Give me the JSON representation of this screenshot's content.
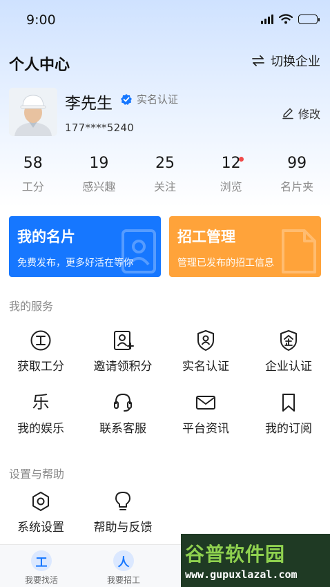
{
  "status_bar": {
    "time": "9:00"
  },
  "header": {
    "title": "个人中心",
    "switch_label": "切换企业"
  },
  "profile": {
    "name": "李先生",
    "verified_label": "实名认证",
    "phone": "177****5240",
    "edit_label": "修改"
  },
  "stats": [
    {
      "value": "58",
      "label": "工分"
    },
    {
      "value": "19",
      "label": "感兴趣"
    },
    {
      "value": "25",
      "label": "关注"
    },
    {
      "value": "12",
      "label": "浏览",
      "has_dot": true
    },
    {
      "value": "99",
      "label": "名片夹"
    }
  ],
  "cards": {
    "business_card": {
      "title": "我的名片",
      "subtitle": "免费发布，更多好活在等你",
      "color": "#1677ff"
    },
    "recruit_manage": {
      "title": "招工管理",
      "subtitle": "管理已发布的招工信息",
      "color": "#ffa33a"
    }
  },
  "services": {
    "title": "我的服务",
    "items": [
      {
        "label": "获取工分",
        "icon": "work-points-icon"
      },
      {
        "label": "邀请领积分",
        "icon": "invite-user-icon"
      },
      {
        "label": "实名认证",
        "icon": "id-shield-icon"
      },
      {
        "label": "企业认证",
        "icon": "enterprise-shield-icon"
      },
      {
        "label": "我的娱乐",
        "icon": "music-icon",
        "glyph": "乐"
      },
      {
        "label": "联系客服",
        "icon": "headset-icon"
      },
      {
        "label": "平台资讯",
        "icon": "mail-icon"
      },
      {
        "label": "我的订阅",
        "icon": "bookmark-icon"
      }
    ]
  },
  "settings": {
    "title": "设置与帮助",
    "items": [
      {
        "label": "系统设置",
        "icon": "settings-hex-icon"
      },
      {
        "label": "帮助与反馈",
        "icon": "lightbulb-icon"
      }
    ]
  },
  "tabbar": {
    "items": [
      {
        "label": "我要找活",
        "glyph": "工"
      },
      {
        "label": "我要招工",
        "glyph": "人"
      }
    ]
  },
  "watermark": {
    "top": "谷普软件园",
    "bottom": "www.gupuxlazal.com"
  }
}
